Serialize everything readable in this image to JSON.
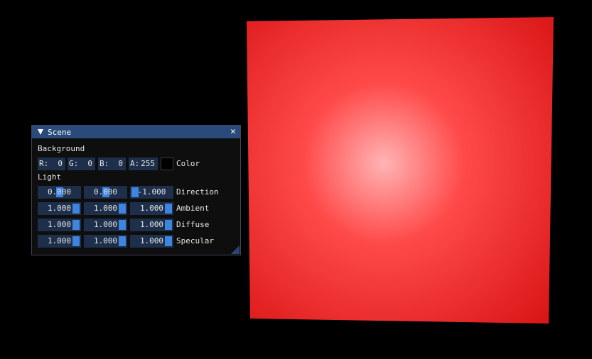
{
  "scene": {
    "quad_color": "#e41818",
    "highlight_color": "#ffb4b4"
  },
  "window": {
    "title": "Scene",
    "close_glyph": "✕",
    "background_label": "Background",
    "background": {
      "r_label": "R:",
      "r_value": "0",
      "g_label": "G:",
      "g_value": "0",
      "b_label": "B:",
      "b_value": "0",
      "a_label": "A:",
      "a_value": "255",
      "swatch_color": "#000000",
      "color_label": "Color"
    },
    "light_label": "Light",
    "rows": [
      {
        "label": "Direction",
        "values": [
          "0.000",
          "0.000",
          "-1.000"
        ],
        "levels": [
          0.5,
          0.5,
          0.0
        ]
      },
      {
        "label": "Ambient",
        "values": [
          "1.000",
          "1.000",
          "1.000"
        ],
        "levels": [
          1.0,
          1.0,
          1.0
        ]
      },
      {
        "label": "Diffuse",
        "values": [
          "1.000",
          "1.000",
          "1.000"
        ],
        "levels": [
          1.0,
          1.0,
          1.0
        ]
      },
      {
        "label": "Specular",
        "values": [
          "1.000",
          "1.000",
          "1.000"
        ],
        "levels": [
          1.0,
          1.0,
          1.0
        ]
      }
    ]
  }
}
